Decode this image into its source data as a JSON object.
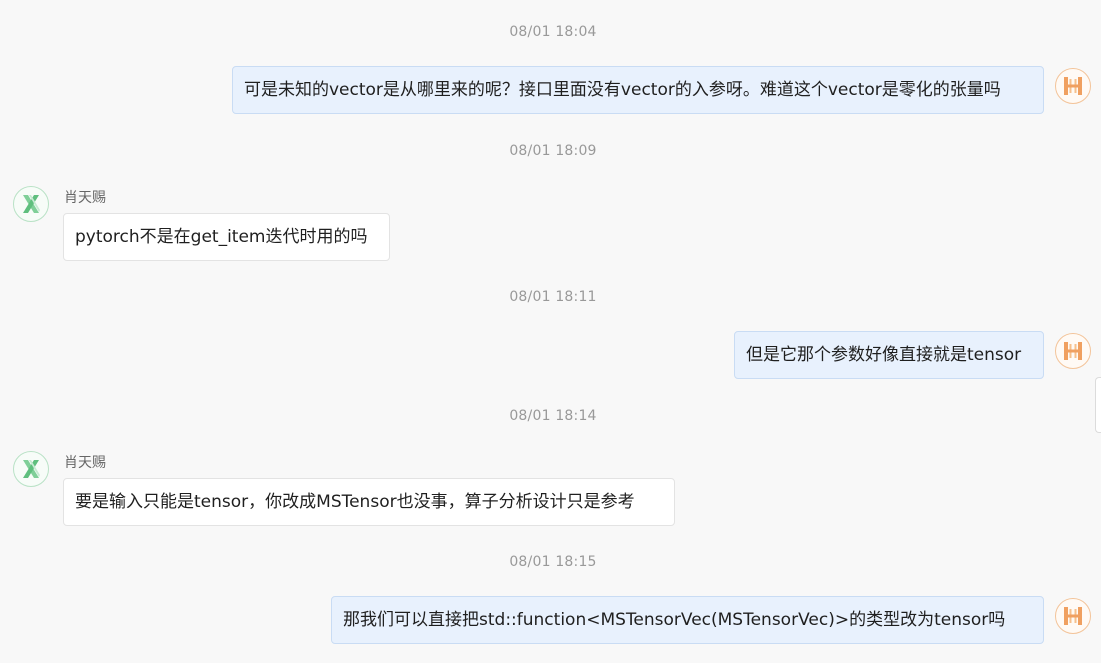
{
  "messages": [
    {
      "time": "08/01 18:04",
      "from": "self",
      "text": "可是未知的vector是从哪里来的呢？接口里面没有vector的入参呀。难道这个vector是零化的张量吗"
    },
    {
      "time": "08/01 18:09",
      "from": "other",
      "sender": "肖天赐",
      "text": "pytorch不是在get_item迭代时用的吗"
    },
    {
      "time": "08/01 18:11",
      "from": "self",
      "text": "但是它那个参数好像直接就是tensor"
    },
    {
      "time": "08/01 18:14",
      "from": "other",
      "sender": "肖天赐",
      "text": "要是输入只能是tensor，你改成MSTensor也没事，算子分析设计只是参考"
    },
    {
      "time": "08/01 18:15",
      "from": "self",
      "text": "那我们可以直接把std::function<MSTensorVec(MSTensorVec)>的类型改为tensor吗"
    }
  ],
  "avatars": {
    "self": {
      "icon": "h-logo-icon",
      "color": "#f0a060"
    },
    "other": {
      "icon": "x-logo-icon",
      "color": "#5fbf7e"
    }
  },
  "colors": {
    "background": "#f8f8f8",
    "self_bubble": "#e8f1fd",
    "other_bubble": "#ffffff",
    "timestamp": "#999999"
  }
}
